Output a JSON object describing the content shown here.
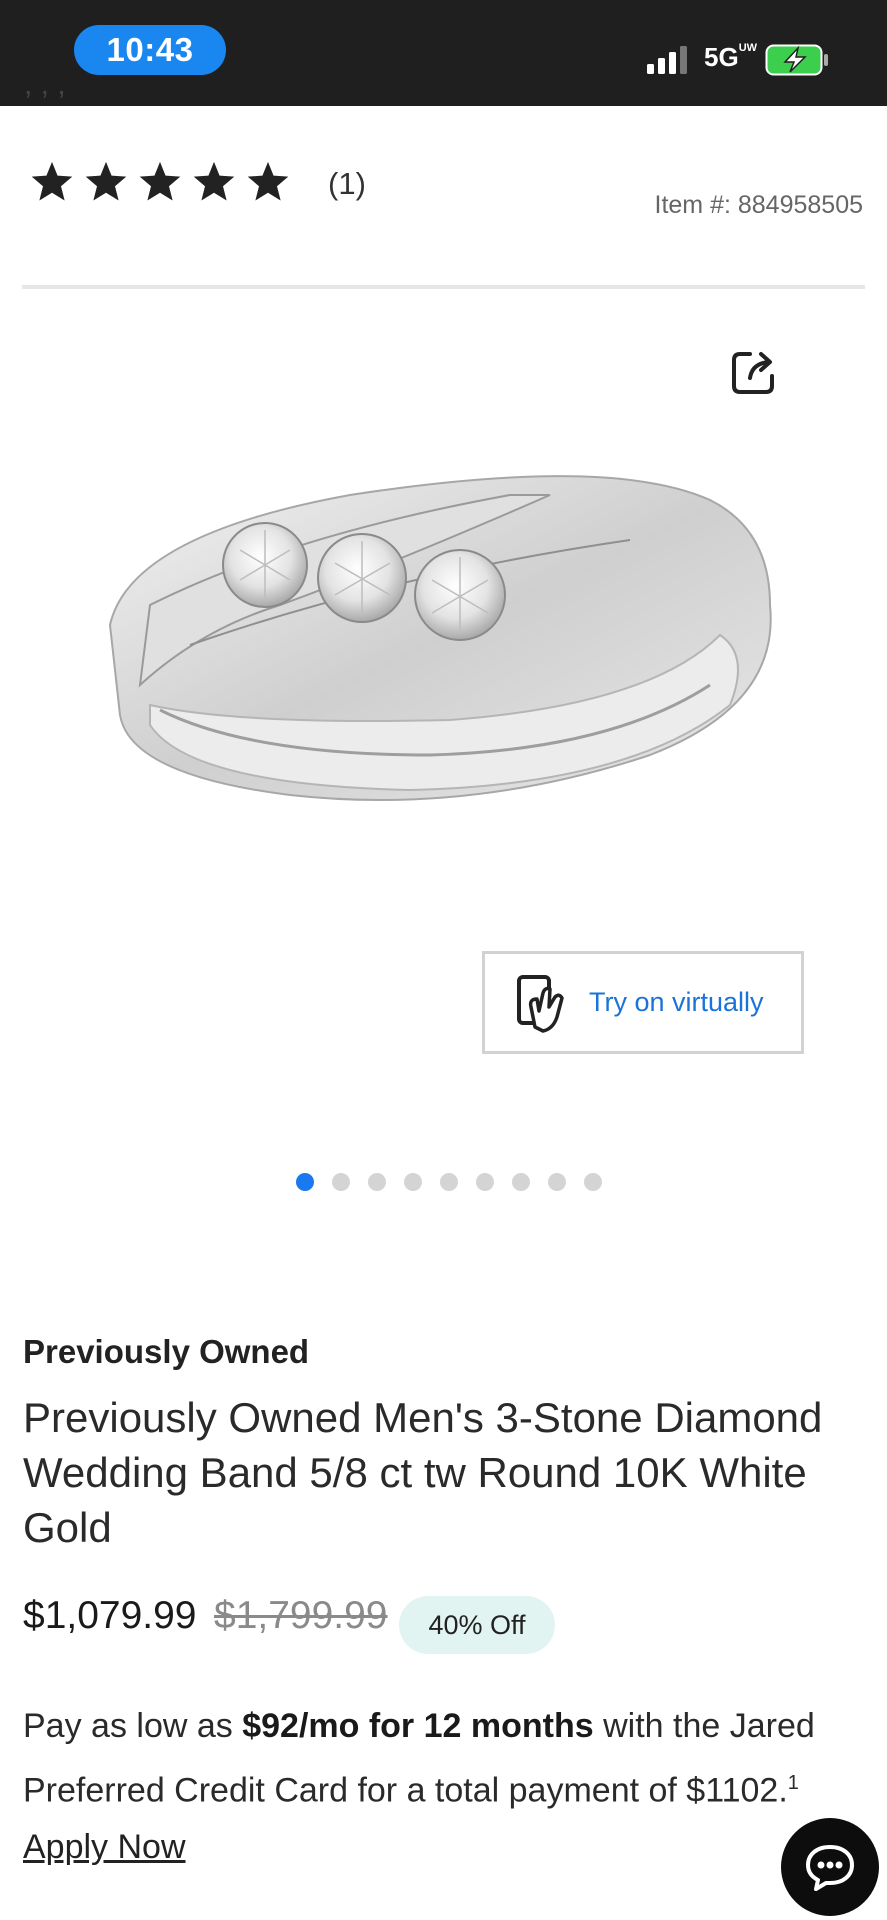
{
  "status_bar": {
    "time": "10:43",
    "network": "5G",
    "network_superscript": "UW"
  },
  "top_cutoff_text": ", , ,",
  "rating": {
    "stars": 5,
    "review_count": "(1)",
    "item_number": "Item #: 884958505"
  },
  "icons": {
    "share": "share-icon",
    "try_on": "hand-phone-icon",
    "chat": "chat-bubble-icon"
  },
  "try_on_label": "Try on virtually",
  "carousel": {
    "total": 9,
    "active_index": 0
  },
  "product": {
    "category": "Previously Owned",
    "title": "Previously Owned Men's 3-Stone Diamond Wedding Band 5/8 ct tw Round 10K White Gold",
    "price": "$1,079.99",
    "original_price": "$1,799.99",
    "discount": "40% Off"
  },
  "financing": {
    "prefix": "Pay as low as ",
    "amount_bold": "$92/mo for 12 months",
    "middle": " with the Jared Preferred Credit Card for a total payment of $1102.",
    "footnote": "1",
    "apply_link": "Apply Now"
  },
  "colors": {
    "status_bar_bg": "#1f1f1f",
    "accent_blue": "#1a78f0",
    "discount_bg": "#e2f4f1",
    "divider": "#e6e6e6"
  }
}
